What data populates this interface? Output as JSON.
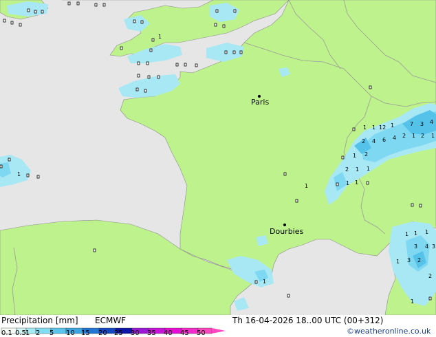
{
  "map": {
    "cities": [
      {
        "name": "Paris"
      },
      {
        "name": "Dourbies"
      }
    ],
    "precip_labels": [
      "1",
      "1",
      "1",
      "1",
      "1",
      "12",
      "1",
      "7",
      "3",
      "4",
      "2",
      "4",
      "6",
      "4",
      "2",
      "1",
      "2",
      "1",
      "1",
      "2",
      "2",
      "1",
      "1",
      "1",
      "1",
      "1",
      "1",
      "1",
      "3",
      "4",
      "3",
      "1",
      "3",
      "2",
      "2",
      "1",
      "1"
    ]
  },
  "legend": {
    "title": "Precipitation [mm]",
    "model": "ECMWF",
    "ticks": [
      "0.1",
      "0.5",
      "1",
      "2",
      "5",
      "10",
      "15",
      "20",
      "25",
      "30",
      "35",
      "40",
      "45",
      "50"
    ],
    "colors": [
      "#f5fdf5",
      "#d2f5f5",
      "#a6ebf3",
      "#82dcf2",
      "#5ac4ea",
      "#3ba5e0",
      "#2076d3",
      "#1547c0",
      "#0d16a8",
      "#9b19d6",
      "#c813d9",
      "#e60ed4",
      "#f42ccb",
      "#ff46c1"
    ]
  },
  "run": {
    "valid_time": "Th 16-04-2026 18..00 UTC (00+312)"
  },
  "credit": "©weatheronline.co.uk",
  "colors": {
    "land": "#bef28c",
    "sea": "#e6e6e6",
    "border": "#9a9a9a",
    "coast": "#8c8c8c",
    "rain_light": "#a8e8f4",
    "rain_mid": "#7fd8f2",
    "rain_heavy": "#55c2ea"
  }
}
